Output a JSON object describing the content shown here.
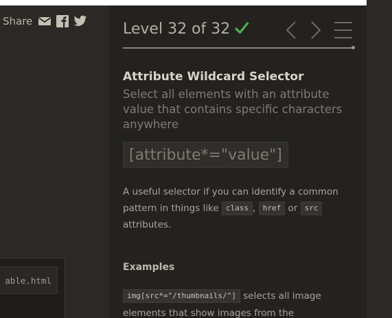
{
  "share": {
    "label": "Share",
    "icons": [
      "envelope-icon",
      "facebook-icon",
      "twitter-icon"
    ]
  },
  "editor": {
    "tab_filename": "able.html"
  },
  "level": {
    "title": "Level 32 of 32",
    "completed": true,
    "progress_fraction": 1.0
  },
  "lesson": {
    "selector_name": "Attribute Wildcard Selector",
    "description": "Select all elements with an attribute value that contains specific characters anywhere",
    "syntax": "[attribute*=\"value\"]",
    "hint_prefix": "A useful selector if you can identify a common pattern in things like",
    "hint_codes": [
      "class",
      "href",
      "src"
    ],
    "hint_sep": ",",
    "hint_or": "or",
    "hint_suffix": "attributes.",
    "examples_heading": "Examples",
    "example_code": "img[src*=\"/thumbnails/\"]",
    "example_text": "selects all image elements that show images from the"
  },
  "colors": {
    "check": "#4caf50",
    "sidebar_bg": "#24221f"
  }
}
